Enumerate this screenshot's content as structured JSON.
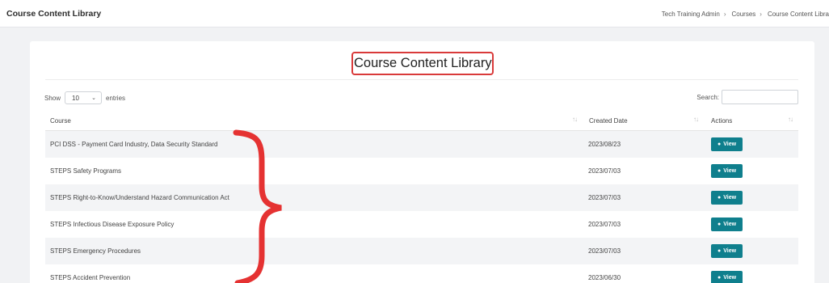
{
  "header": {
    "app_title": "Course Content Library",
    "breadcrumb": [
      "Tech Training Admin",
      "Courses",
      "Course Content Libra"
    ],
    "breadcrumb_separator": "›"
  },
  "page": {
    "heading": "Course Content Library",
    "highlight_color": "#d93a3a"
  },
  "table_controls": {
    "show_label": "Show",
    "entries_value": "10",
    "entries_label": "entries",
    "search_label": "Search:",
    "search_value": ""
  },
  "table": {
    "columns": [
      "Course",
      "Created Date",
      "Actions"
    ],
    "rows": [
      {
        "course": "PCI DSS - Payment Card Industry, Data Security Standard",
        "created": "2023/08/23",
        "action": "View"
      },
      {
        "course": "STEPS Safety Programs",
        "created": "2023/07/03",
        "action": "View"
      },
      {
        "course": "STEPS Right-to-Know/Understand Hazard Communication Act",
        "created": "2023/07/03",
        "action": "View"
      },
      {
        "course": "STEPS Infectious Disease Exposure Policy",
        "created": "2023/07/03",
        "action": "View"
      },
      {
        "course": "STEPS Emergency Procedures",
        "created": "2023/07/03",
        "action": "View"
      },
      {
        "course": "STEPS Accident Prevention",
        "created": "2023/06/30",
        "action": "View"
      }
    ],
    "button_color": "#0f7f8d"
  },
  "icons": {
    "view": "eye-icon",
    "sort": "sort-icon",
    "dropdown": "chevron-down-icon"
  }
}
